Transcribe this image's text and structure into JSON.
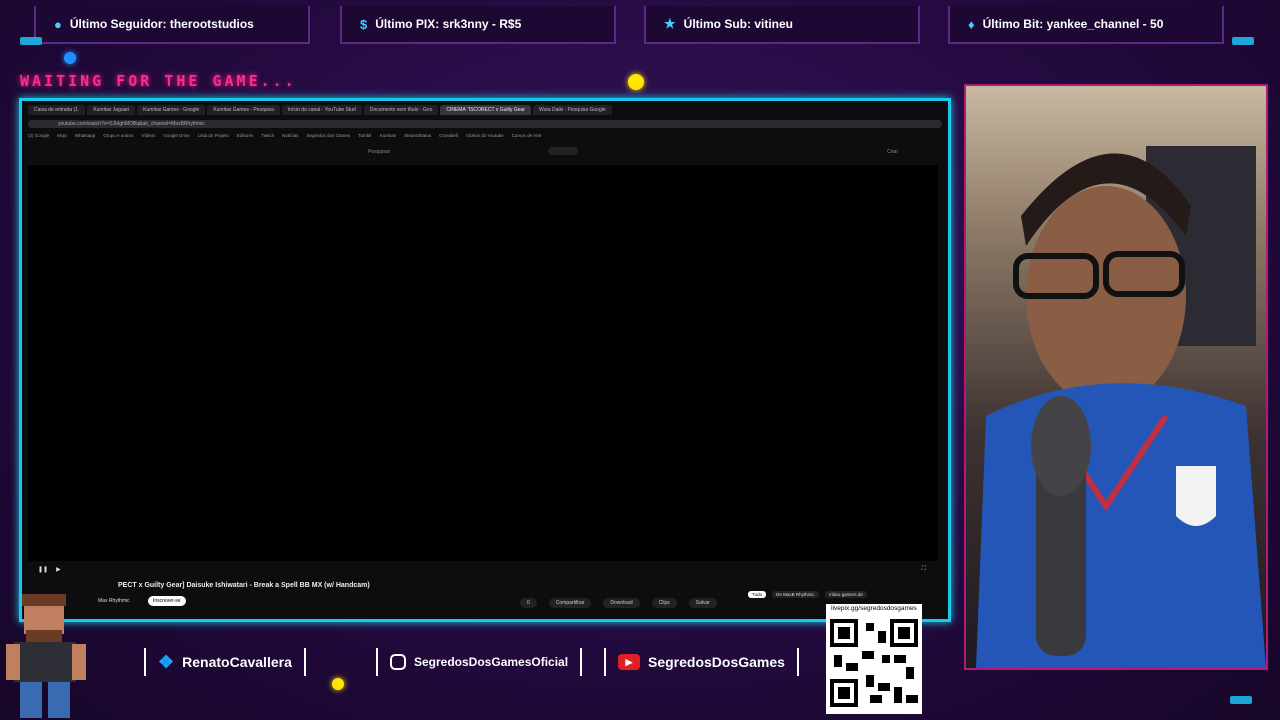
{
  "alerts": [
    {
      "icon": "user-icon",
      "label": "Último Seguidor: therootstudios"
    },
    {
      "icon": "dollar-icon",
      "label": "Último PIX: srk3nny - R$5"
    },
    {
      "icon": "star-icon",
      "label": "Último Sub: vitineu"
    },
    {
      "icon": "diamond-icon",
      "label": "Último Bit: yankee_channel - 50"
    }
  ],
  "waiting_text": "WAITING FOR THE GAME...",
  "browser": {
    "tabs": [
      "Caixa de entrada (1.",
      "Kumitas Jaguari",
      "Kumitas Games - Google",
      "Kumitas Games - Pesquisa",
      "Início do canal - YouTube Stud",
      "Documento sem título - Goo",
      "CINEMA \"ISCORECT x Guilty Gear",
      "Wuta Daiki - Pesquisa Google"
    ],
    "url": "youtube.com/watch?v=SJbIghMOBq&ab_channel=MaxBRhythmic",
    "bookmarks": [
      "(2) Google",
      "Mojo",
      "Whatsapp",
      "Grupo e outros",
      "Vídeos",
      "Google Drive",
      "Lista do Projeto",
      "Editores",
      "Twitch",
      "Notícias",
      "Segredos dos Games",
      "Tumblr",
      "Kumitas",
      "Steam/Status",
      "Crossbell",
      "Vídeos do Youtube",
      "Cursos de Arte"
    ],
    "search_placeholder": "Pesquisar",
    "signin": "Criar",
    "video_title": "PECT x Guilty Gear] Daisuke Ishiwatari - Break a Spell BB MX (w/ Handcam)",
    "channel": "Max Rhythmic",
    "subscribe": "Inscrever-se",
    "actions": [
      "0",
      "Compartilhar",
      "Download",
      "Clips",
      "Salvar"
    ],
    "chips": [
      "Tudo",
      "De MaxB Rhythmic",
      "Vídeo gamers de"
    ]
  },
  "socials": [
    {
      "icon": "twitter-icon",
      "label": "RenatoCavallera"
    },
    {
      "icon": "instagram-icon",
      "label": "SegredosDosGamesOficial"
    },
    {
      "icon": "youtube-icon",
      "label": "SegredosDosGames"
    }
  ],
  "qr": {
    "url": "livepix.gg/segredosdosgames"
  },
  "colors": {
    "frame": "#19c9e8",
    "accent": "#ff2a8a",
    "cam_border": "#b21a7a"
  }
}
